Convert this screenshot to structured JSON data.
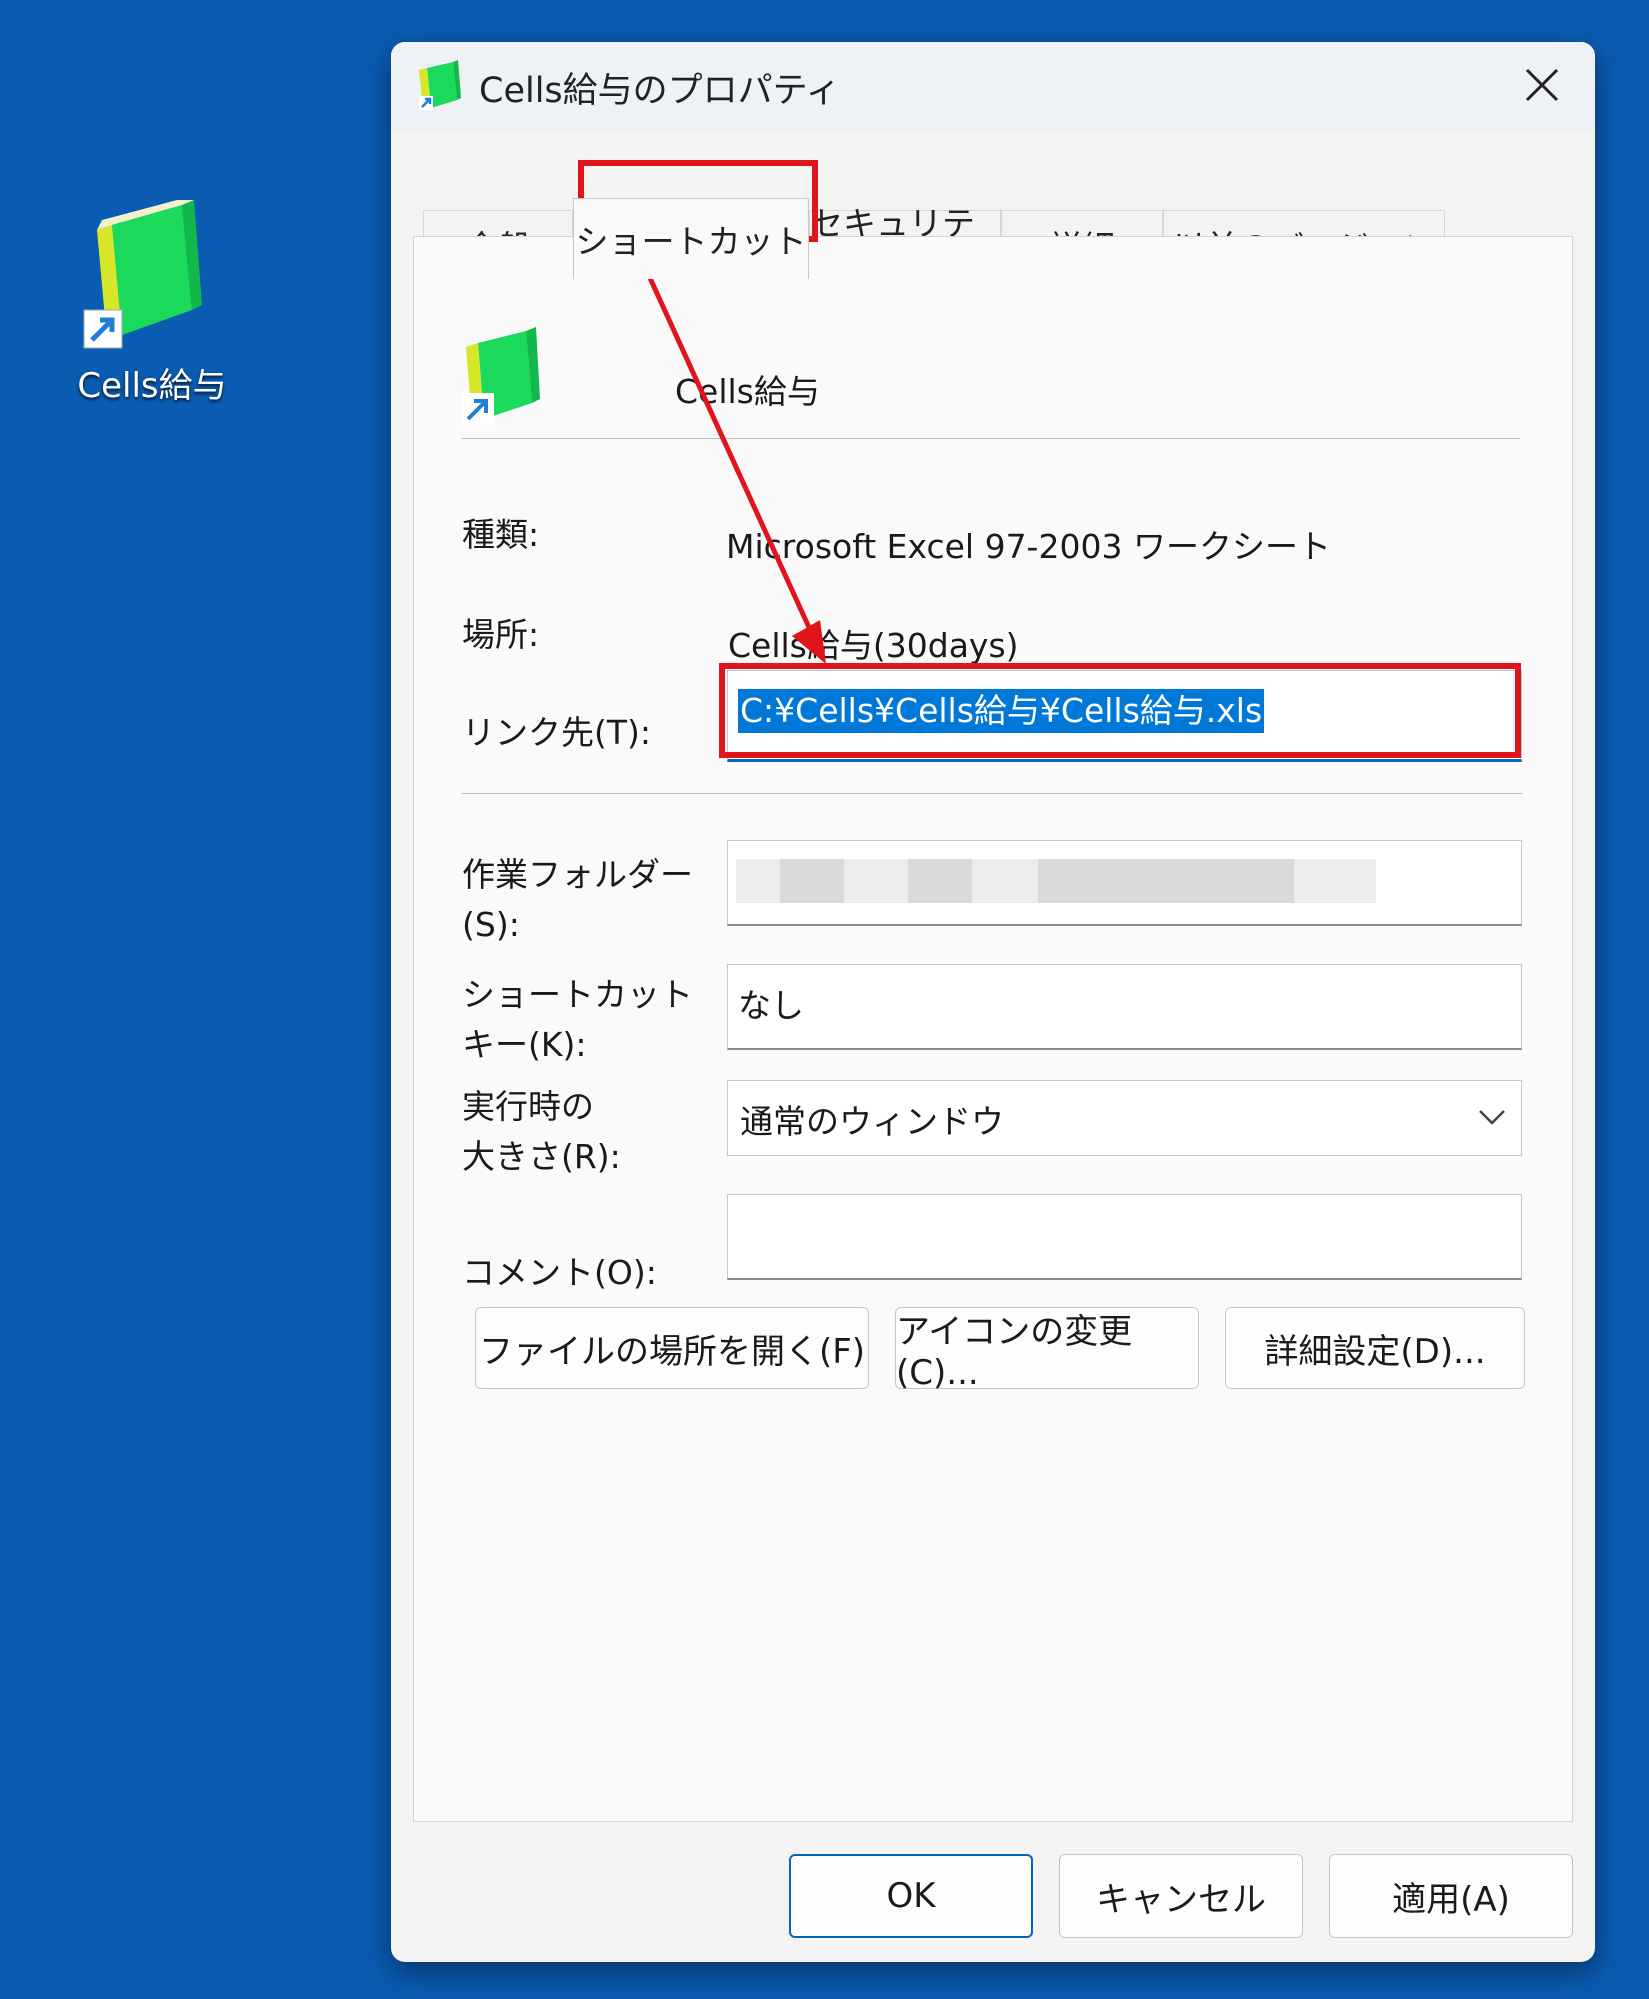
{
  "desktop": {
    "icon_label": "Cells給与"
  },
  "dialog": {
    "title": "Cells給与のプロパティ",
    "tabs": [
      "全般",
      "ショートカット",
      "セキュリティ",
      "詳細",
      "以前のバージョン"
    ],
    "active_tab": "ショートカット",
    "file_name": "Cells給与",
    "rows": {
      "type_label": "種類:",
      "type_value": "Microsoft Excel 97-2003 ワークシート",
      "location_label": "場所:",
      "location_value": "Cells給与(30days)",
      "target_label": "リンク先(T):",
      "target_value": "C:¥Cells¥Cells給与¥Cells給与.xls",
      "workdir_label_1": "作業フォルダー",
      "workdir_label_2": "(S):",
      "shortcut_key_label_1": "ショートカット",
      "shortcut_key_label_2": "キー(K):",
      "shortcut_key_value": "なし",
      "run_label_1": "実行時の",
      "run_label_2": "大きさ(R):",
      "run_value": "通常のウィンドウ",
      "comment_label": "コメント(O):",
      "comment_value": ""
    },
    "buttons": {
      "open_location": "ファイルの場所を開く(F)",
      "change_icon": "アイコンの変更(C)...",
      "advanced": "詳細設定(D)...",
      "ok": "OK",
      "cancel": "キャンセル",
      "apply": "適用(A)"
    }
  },
  "colors": {
    "desktop": "#0a5cb3",
    "highlight": "#e0151b",
    "selection": "#0078d7"
  }
}
